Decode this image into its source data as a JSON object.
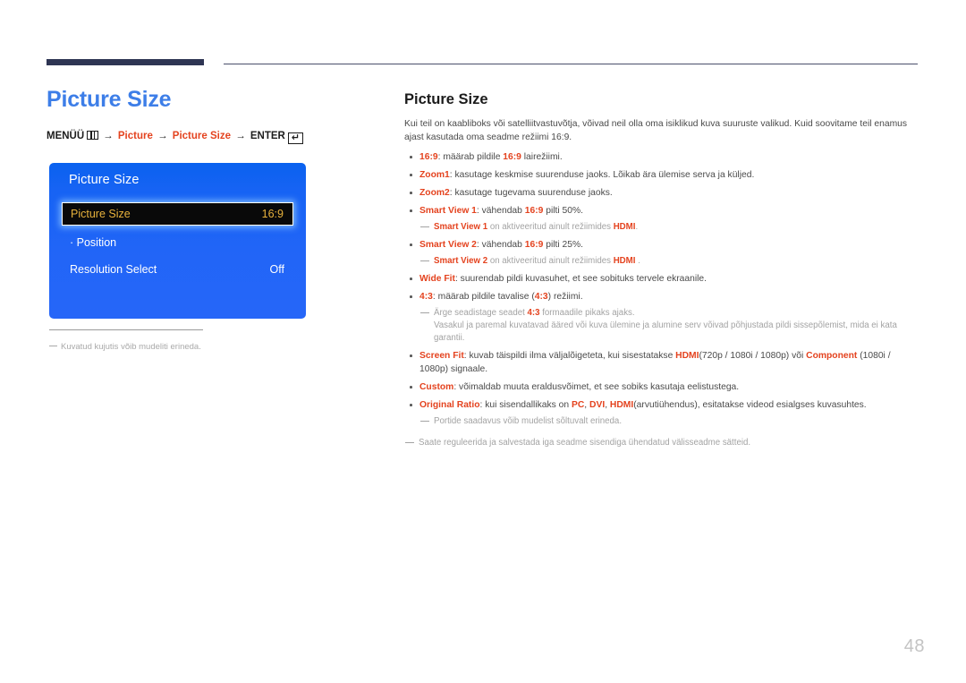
{
  "page": {
    "number": "48",
    "accent_blue": "#3d7ee8",
    "accent_red": "#e4431f",
    "rule_navy": "#2e3553",
    "osd_blue": "#1763f4",
    "osd_highlight_text": "#e8b23c"
  },
  "left": {
    "title": "Picture Size",
    "breadcrumb": {
      "menu_label": "MENÜÜ",
      "menu_icon": "menu-grid-icon",
      "arrow": "→",
      "crumb1": "Picture",
      "crumb2": "Picture Size",
      "enter_label": "ENTER",
      "enter_icon": "enter-return-icon",
      "enter_glyph": "↵"
    },
    "osd": {
      "title": "Picture Size",
      "rows": [
        {
          "label": "Picture Size",
          "value": "16:9",
          "selected": true
        },
        {
          "label": "· Position",
          "value": "",
          "selected": false
        },
        {
          "label": "Resolution Select",
          "value": "Off",
          "selected": false
        }
      ]
    },
    "footnote": "Kuvatud kujutis võib mudeliti erineda."
  },
  "right": {
    "title": "Picture Size",
    "intro": "Kui teil on kaabliboks või satelliitvastuvõtja, võivad neil olla oma isiklikud kuva suuruste valikud. Kuid soovitame teil enamus ajast kasutada oma seadme režiimi 16:9.",
    "items": [
      {
        "key": "16:9",
        "text_a": ": määrab pildile ",
        "key2": "16:9",
        "text_b": " lairežiimi."
      },
      {
        "key": "Zoom1",
        "text_a": ": kasutage keskmise suurenduse jaoks. Lõikab ära ülemise serva ja küljed.",
        "key2": "",
        "text_b": ""
      },
      {
        "key": "Zoom2",
        "text_a": ": kasutage tugevama suurenduse jaoks.",
        "key2": "",
        "text_b": ""
      },
      {
        "key": "Smart View 1",
        "text_a": ": vähendab ",
        "key2": "16:9",
        "text_b": " pilti 50%."
      }
    ],
    "note_sv1": {
      "kw1": "Smart View 1",
      "mid": " on aktiveeritud ainult režiimides ",
      "kw2": "HDMI",
      "tail": "."
    },
    "item_sv2": {
      "key": "Smart View 2",
      "text_a": ": vähendab ",
      "key2": "16:9",
      "text_b": " pilti 25%."
    },
    "note_sv2": {
      "kw1": "Smart View 2",
      "mid": " on aktiveeritud ainult režiimides ",
      "kw2": "HDMI",
      "tail": " ."
    },
    "item_widefit": {
      "key": "Wide Fit",
      "text_a": ": suurendab pildi kuvasuhet, et see sobituks tervele ekraanile."
    },
    "item_43": {
      "key": "4:3",
      "text_a": ": määrab pildile tavalise (",
      "key2": "4:3",
      "text_b": ") režiimi."
    },
    "note_43": {
      "pre": "Ärge seadistage seadet ",
      "kw": "4:3",
      "post": " formaadile pikaks ajaks.",
      "cont": "Vasakul ja paremal kuvatavad ääred või kuva ülemine ja alumine serv võivad põhjustada pildi sissepõlemist, mida ei kata garantii."
    },
    "item_screenfit": {
      "key": "Screen Fit",
      "text_a": ": kuvab täispildi ilma väljalõigeteta, kui sisestatakse ",
      "key2": "HDMI",
      "text_b": "(720p / 1080i / 1080p) või ",
      "key3": "Component",
      "text_c": " (1080i / 1080p) signaale."
    },
    "item_custom": {
      "key": "Custom",
      "text_a": ": võimaldab muuta eraldusvõimet, et see sobiks kasutaja eelistustega."
    },
    "item_original": {
      "key": "Original Ratio",
      "text_a": ": kui sisendallikaks on ",
      "key2": "PC",
      "text_b": ", ",
      "key3": "DVI",
      "text_c": ", ",
      "key4": "HDMI",
      "text_d": "(arvutiühendus), esitatakse videod esialgses kuvasuhtes."
    },
    "note_ports": "Portide saadavus võib mudelist sõltuvalt erineda.",
    "note_save": "Saate reguleerida ja salvestada iga seadme sisendiga ühendatud välisseadme sätteid."
  }
}
